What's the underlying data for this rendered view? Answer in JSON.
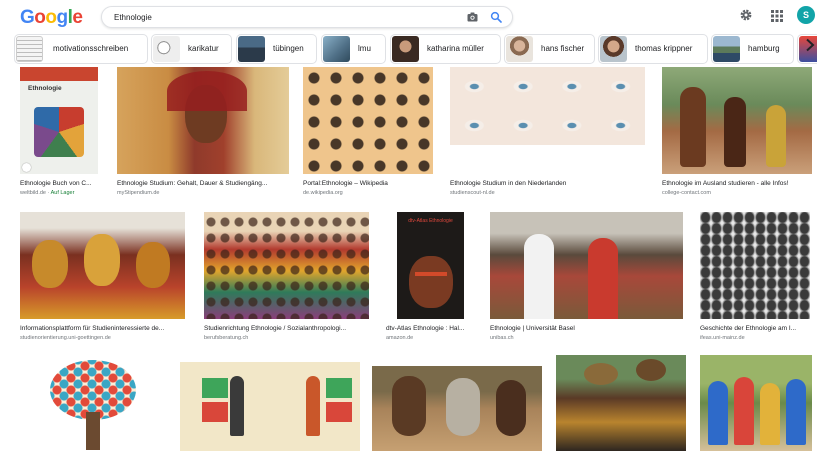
{
  "header": {
    "logo_letters": [
      "G",
      "o",
      "o",
      "g",
      "l",
      "e"
    ],
    "logo_colors": [
      "#4285f4",
      "#ea4335",
      "#fbbc05",
      "#4285f4",
      "#34a853",
      "#ea4335"
    ],
    "search_value": "Ethnologie",
    "avatar_letter": "S"
  },
  "chips": [
    {
      "label": "motivationsschreiben"
    },
    {
      "label": "karikatur"
    },
    {
      "label": "tübingen"
    },
    {
      "label": "lmu"
    },
    {
      "label": "katharina müller"
    },
    {
      "label": "hans fischer"
    },
    {
      "label": "thomas krippner"
    },
    {
      "label": "hamburg"
    }
  ],
  "results": [
    {
      "caption": "Ethnologie Buch von C...",
      "source": "weltbild.de",
      "extra": "Auf Lager"
    },
    {
      "caption": "Ethnologie Studium: Gehalt, Dauer & Studiengäng...",
      "source": "myStipendium.de"
    },
    {
      "caption": "Portal:Ethnologie – Wikipedia",
      "source": "de.wikipedia.org"
    },
    {
      "caption": "Ethnologie Studium in den Niederlanden",
      "source": "studienscout-nl.de"
    },
    {
      "caption": "Ethnologie im Ausland studieren - alle Infos!",
      "source": "college-contact.com"
    },
    {
      "caption": "Informationsplattform für Studieninteressierte de...",
      "source": "studienorientierung.uni-goettingen.de"
    },
    {
      "caption": "Studienrichtung Ethnologie / Sozialanthropologi...",
      "source": "berufsberatung.ch"
    },
    {
      "caption": "dtv-Atlas Ethnologie : Hal...",
      "source": "amazon.de"
    },
    {
      "caption": "Ethnologie | Universität Basel",
      "source": "unibas.ch"
    },
    {
      "caption": "Geschichte der Ethnologie am I...",
      "source": "ifeas.uni-mainz.de"
    }
  ],
  "image_texts": {
    "book_cover_title": "Ethnologie",
    "atlas_cover_title": "dtv-Atlas Ethnologie"
  }
}
